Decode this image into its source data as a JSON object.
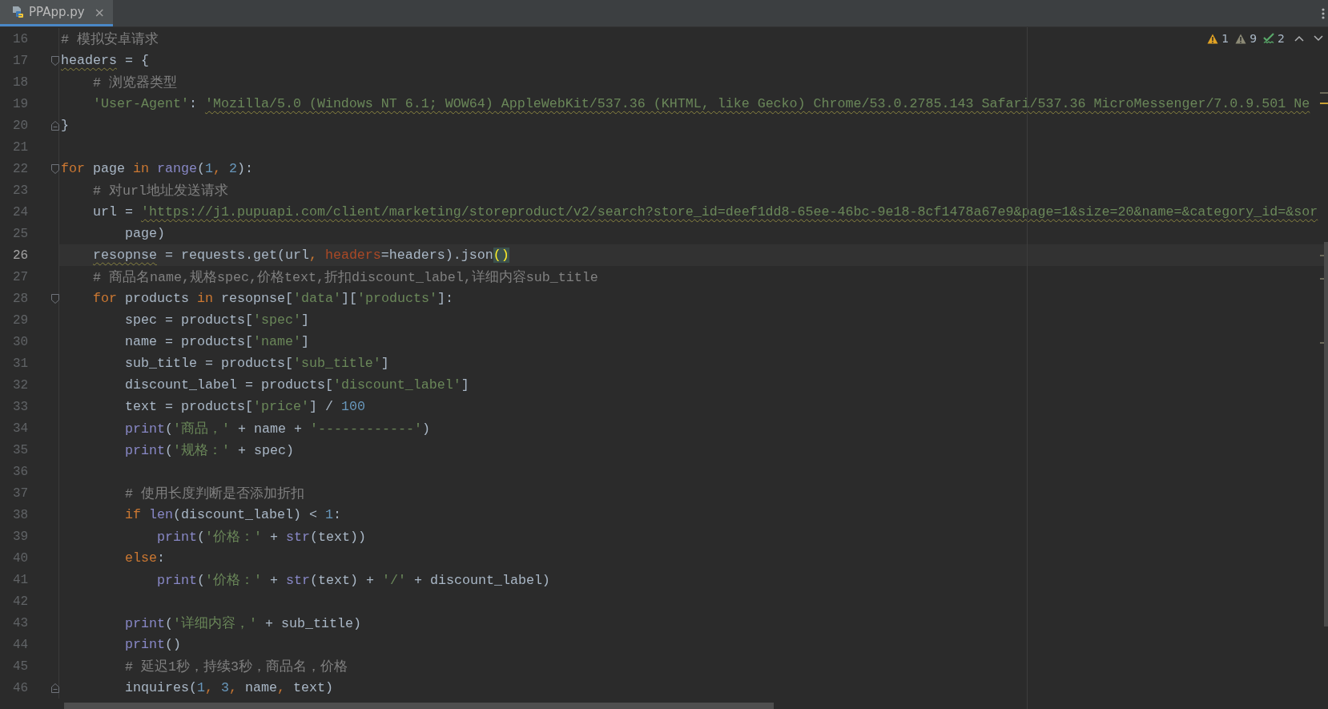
{
  "tabs": [
    {
      "label": "PPApp.py",
      "selected": true,
      "close": "×"
    }
  ],
  "inspections": [
    {
      "kind": "warning",
      "count": "1"
    },
    {
      "kind": "weak",
      "count": "9"
    },
    {
      "kind": "typo",
      "count": "2"
    }
  ],
  "editor": {
    "lines": [
      {
        "number": "16",
        "current": false,
        "tokens": [
          {
            "kind": "comment",
            "s": "# 模拟安卓请求"
          }
        ]
      },
      {
        "number": "17",
        "current": false,
        "fold_start": true,
        "tokens": [
          {
            "kind": "plain",
            "s": "headers",
            "warn": true
          },
          {
            "kind": "plain",
            "s": " = {"
          }
        ]
      },
      {
        "number": "18",
        "current": false,
        "tokens": [
          {
            "kind": "comment",
            "s": "    # 浏览器类型"
          }
        ]
      },
      {
        "number": "19",
        "current": false,
        "tokens": [
          {
            "kind": "string",
            "s": "    'User-Agent'"
          },
          {
            "kind": "plain",
            "s": ": "
          },
          {
            "kind": "string",
            "s": "'Mozilla/5.0 (Windows NT 6.1; WOW64) AppleWebKit/537.36 (KHTML, like Gecko) Chrome/53.0.2785.143 Safari/537.36 MicroMessenger/7.0.9.501 Ne",
            "warn": true
          }
        ]
      },
      {
        "number": "20",
        "current": false,
        "fold_end": true,
        "tokens": [
          {
            "kind": "plain",
            "s": "}"
          }
        ]
      },
      {
        "number": "21",
        "current": false
      },
      {
        "number": "22",
        "current": false,
        "fold_start": true,
        "tokens": [
          {
            "kind": "keyword",
            "s": "for"
          },
          {
            "kind": "plain",
            "s": " page "
          },
          {
            "kind": "keyword",
            "s": "in"
          },
          {
            "kind": "builtin",
            "s": " range"
          },
          {
            "kind": "plain",
            "s": "("
          },
          {
            "kind": "number",
            "s": "1"
          },
          {
            "kind": "punct",
            "s": ", "
          },
          {
            "kind": "number",
            "s": "2"
          },
          {
            "kind": "plain",
            "s": "):"
          }
        ]
      },
      {
        "number": "23",
        "current": false,
        "tokens": [
          {
            "kind": "comment",
            "s": "    # 对url地址发送请求"
          }
        ]
      },
      {
        "number": "24",
        "current": false,
        "tokens": [
          {
            "kind": "plain",
            "s": "    url = "
          },
          {
            "kind": "string",
            "s": "'https://j1.pupuapi.com/client/marketing/storeproduct/v2/search?store_id=deef1dd8-65ee-46bc-9e18-8cf1478a67e9&page=1&size=20&name=&category_id=&sor",
            "warn": true
          }
        ]
      },
      {
        "number": "25",
        "current": false,
        "tokens": [
          {
            "kind": "plain",
            "s": "        page)"
          }
        ]
      },
      {
        "number": "26",
        "current": true,
        "tokens": [
          {
            "kind": "plain",
            "s": "    resopnse",
            "warn": true
          },
          {
            "kind": "plain",
            "s": " = requests.get(url"
          },
          {
            "kind": "punct",
            "s": ", "
          },
          {
            "kind": "param",
            "s": "headers"
          },
          {
            "kind": "plain",
            "s": "=headers).json"
          },
          {
            "kind": "match",
            "s": "()"
          }
        ]
      },
      {
        "number": "27",
        "current": false,
        "tokens": [
          {
            "kind": "comment",
            "s": "    # 商品名name,规格spec,价格text,折扣discount_label,详细内容sub_title"
          }
        ]
      },
      {
        "number": "28",
        "current": false,
        "fold_start": true,
        "tokens": [
          {
            "kind": "keyword",
            "s": "    for"
          },
          {
            "kind": "plain",
            "s": " products "
          },
          {
            "kind": "keyword",
            "s": "in"
          },
          {
            "kind": "plain",
            "s": " resopnse["
          },
          {
            "kind": "string",
            "s": "'data'"
          },
          {
            "kind": "plain",
            "s": "]["
          },
          {
            "kind": "string",
            "s": "'products'"
          },
          {
            "kind": "plain",
            "s": "]:"
          }
        ]
      },
      {
        "number": "29",
        "current": false,
        "tokens": [
          {
            "kind": "plain",
            "s": "        spec = products["
          },
          {
            "kind": "string",
            "s": "'spec'"
          },
          {
            "kind": "plain",
            "s": "]"
          }
        ]
      },
      {
        "number": "30",
        "current": false,
        "tokens": [
          {
            "kind": "plain",
            "s": "        name = products["
          },
          {
            "kind": "string",
            "s": "'name'"
          },
          {
            "kind": "plain",
            "s": "]"
          }
        ]
      },
      {
        "number": "31",
        "current": false,
        "tokens": [
          {
            "kind": "plain",
            "s": "        sub_title = products["
          },
          {
            "kind": "string",
            "s": "'sub_title'"
          },
          {
            "kind": "plain",
            "s": "]"
          }
        ]
      },
      {
        "number": "32",
        "current": false,
        "tokens": [
          {
            "kind": "plain",
            "s": "        discount_label = products["
          },
          {
            "kind": "string",
            "s": "'discount_label'"
          },
          {
            "kind": "plain",
            "s": "]"
          }
        ]
      },
      {
        "number": "33",
        "current": false,
        "tokens": [
          {
            "kind": "plain",
            "s": "        text = products["
          },
          {
            "kind": "string",
            "s": "'price'"
          },
          {
            "kind": "plain",
            "s": "] / "
          },
          {
            "kind": "number",
            "s": "100"
          }
        ]
      },
      {
        "number": "34",
        "current": false,
        "tokens": [
          {
            "kind": "builtin",
            "s": "        print"
          },
          {
            "kind": "plain",
            "s": "("
          },
          {
            "kind": "string",
            "s": "'商品，'"
          },
          {
            "kind": "plain",
            "s": " + name + "
          },
          {
            "kind": "string",
            "s": "'------------'"
          },
          {
            "kind": "plain",
            "s": ")"
          }
        ]
      },
      {
        "number": "35",
        "current": false,
        "tokens": [
          {
            "kind": "builtin",
            "s": "        print"
          },
          {
            "kind": "plain",
            "s": "("
          },
          {
            "kind": "string",
            "s": "'规格：'"
          },
          {
            "kind": "plain",
            "s": " + spec)"
          }
        ]
      },
      {
        "number": "36",
        "current": false
      },
      {
        "number": "37",
        "current": false,
        "tokens": [
          {
            "kind": "comment",
            "s": "        # 使用长度判断是否添加折扣"
          }
        ]
      },
      {
        "number": "38",
        "current": false,
        "tokens": [
          {
            "kind": "keyword",
            "s": "        if"
          },
          {
            "kind": "builtin",
            "s": " len"
          },
          {
            "kind": "plain",
            "s": "(discount_label) < "
          },
          {
            "kind": "number",
            "s": "1"
          },
          {
            "kind": "plain",
            "s": ":"
          }
        ]
      },
      {
        "number": "39",
        "current": false,
        "tokens": [
          {
            "kind": "builtin",
            "s": "            print"
          },
          {
            "kind": "plain",
            "s": "("
          },
          {
            "kind": "string",
            "s": "'价格：'"
          },
          {
            "kind": "plain",
            "s": " + "
          },
          {
            "kind": "builtin",
            "s": "str"
          },
          {
            "kind": "plain",
            "s": "(text))"
          }
        ]
      },
      {
        "number": "40",
        "current": false,
        "tokens": [
          {
            "kind": "keyword",
            "s": "        else"
          },
          {
            "kind": "plain",
            "s": ":"
          }
        ]
      },
      {
        "number": "41",
        "current": false,
        "tokens": [
          {
            "kind": "builtin",
            "s": "            print"
          },
          {
            "kind": "plain",
            "s": "("
          },
          {
            "kind": "string",
            "s": "'价格：'"
          },
          {
            "kind": "plain",
            "s": " + "
          },
          {
            "kind": "builtin",
            "s": "str"
          },
          {
            "kind": "plain",
            "s": "(text) + "
          },
          {
            "kind": "string",
            "s": "'/'"
          },
          {
            "kind": "plain",
            "s": " + discount_label)"
          }
        ]
      },
      {
        "number": "42",
        "current": false
      },
      {
        "number": "43",
        "current": false,
        "tokens": [
          {
            "kind": "builtin",
            "s": "        print"
          },
          {
            "kind": "plain",
            "s": "("
          },
          {
            "kind": "string",
            "s": "'详细内容，'"
          },
          {
            "kind": "plain",
            "s": " + sub_title)"
          }
        ]
      },
      {
        "number": "44",
        "current": false,
        "tokens": [
          {
            "kind": "builtin",
            "s": "        print"
          },
          {
            "kind": "plain",
            "s": "()"
          }
        ]
      },
      {
        "number": "45",
        "current": false,
        "tokens": [
          {
            "kind": "comment",
            "s": "        # 延迟1秒，持续3秒，商品名，价格"
          }
        ]
      },
      {
        "number": "46",
        "current": false,
        "fold_end": true,
        "tokens": [
          {
            "kind": "plain",
            "s": "        inquires("
          },
          {
            "kind": "number",
            "s": "1"
          },
          {
            "kind": "punct",
            "s": ", "
          },
          {
            "kind": "number",
            "s": "3"
          },
          {
            "kind": "punct",
            "s": ", "
          },
          {
            "kind": "plain",
            "s": "name"
          },
          {
            "kind": "punct",
            "s": ", "
          },
          {
            "kind": "plain",
            "s": "text)"
          }
        ]
      }
    ]
  }
}
